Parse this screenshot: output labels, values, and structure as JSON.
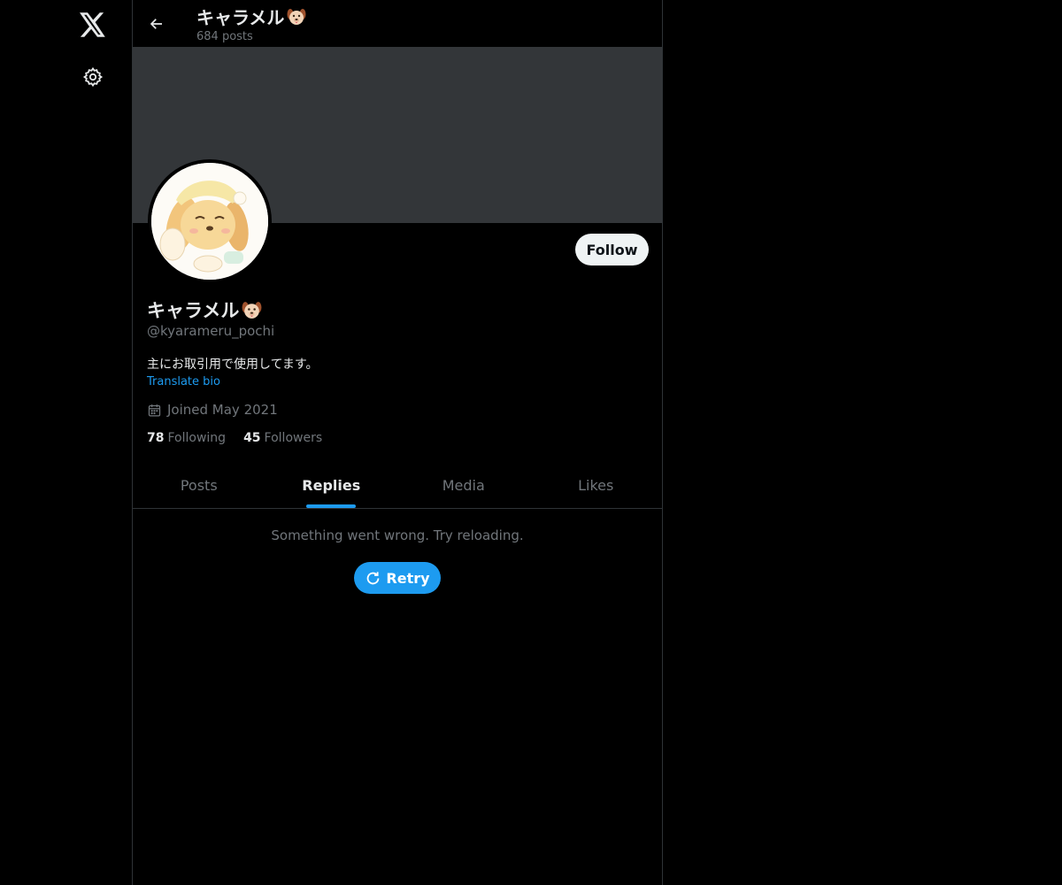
{
  "header": {
    "title": "キャラメル",
    "posts_count": "684 posts"
  },
  "profile": {
    "display_name": "キャラメル",
    "handle": "@kyarameru_pochi",
    "bio": "主にお取引用で使用してます。",
    "translate_label": "Translate bio",
    "joined": "Joined May 2021",
    "following_count": "78",
    "following_label": "Following",
    "followers_count": "45",
    "followers_label": "Followers",
    "follow_button": "Follow",
    "name_emoji_icon": "dog-face-icon"
  },
  "tabs": [
    {
      "label": "Posts",
      "active": false
    },
    {
      "label": "Replies",
      "active": true
    },
    {
      "label": "Media",
      "active": false
    },
    {
      "label": "Likes",
      "active": false
    }
  ],
  "feed": {
    "error_message": "Something went wrong. Try reloading.",
    "retry_label": "Retry"
  },
  "colors": {
    "accent": "#1d9bf0",
    "banner": "#333639",
    "background": "#000000"
  }
}
